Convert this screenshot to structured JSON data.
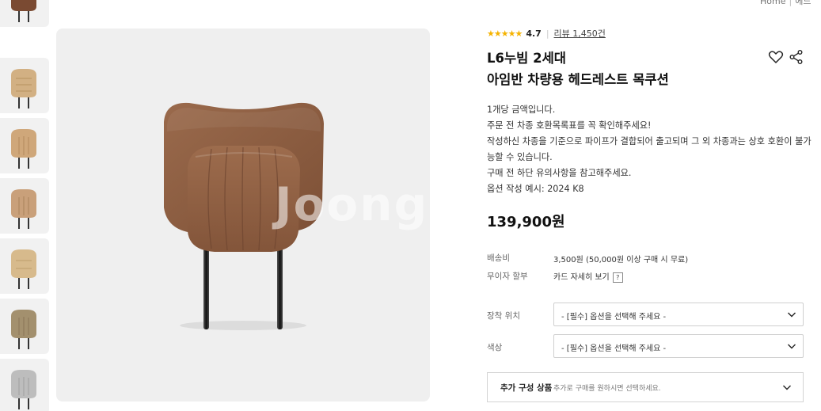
{
  "breadcrumb": {
    "home": "Home",
    "current": "에드"
  },
  "thumbnails": [
    {
      "color": "#7a4a32",
      "alt": "thumb-brown"
    },
    {
      "color": "#d2b083",
      "alt": "thumb-tan"
    },
    {
      "color": "#cfa77a",
      "alt": "thumb-camel"
    },
    {
      "color": "#c9a07a",
      "alt": "thumb-light-brown"
    },
    {
      "color": "#d7ba8c",
      "alt": "thumb-beige"
    },
    {
      "color": "#a3906e",
      "alt": "thumb-khaki"
    },
    {
      "color": "#bdbdbd",
      "alt": "thumb-grey"
    }
  ],
  "main_image": {
    "watermark": "Joongg",
    "product_color": "#8a5a3f"
  },
  "product": {
    "rating_value": "4.7",
    "review_link": "리뷰 1,450건",
    "title_line1": "L6누빔 2세대",
    "title_line2": "아임반 차량용 헤드레스트 목쿠션",
    "description": [
      "1개당 금액입니다.",
      "주문 전 차종 호환목록표를 꼭 확인해주세요!",
      "작성하신 차종을 기준으로 파이프가 결합되어 출고되며 그 외 차종과는 상호 호환이 불가",
      "능할 수 있습니다.",
      "구매 전 하단 유의사항을 참고해주세요.",
      "옵션 작성 예시: 2024 K8"
    ],
    "price": "139,900원"
  },
  "shipping": {
    "label": "배송비",
    "value": "3,500원 (50,000원 이상 구매 시 무료)"
  },
  "installment": {
    "label": "무이자 할부",
    "value": "카드 자세히 보기",
    "help": "?"
  },
  "options": [
    {
      "label": "장착 위치",
      "placeholder": "- [필수] 옵션을 선택해 주세요 -"
    },
    {
      "label": "색상",
      "placeholder": "- [필수] 옵션을 선택해 주세요 -"
    }
  ],
  "addon": {
    "title": "추가 구성 상품",
    "hint": "추가로 구매를 원하시면 선택하세요."
  },
  "icons": {
    "wishlist": "heart-icon",
    "share": "share-icon",
    "rating": "star-icon",
    "dropdown": "chevron-down-icon"
  },
  "colors": {
    "star": "#f5b301",
    "text": "#222222"
  }
}
